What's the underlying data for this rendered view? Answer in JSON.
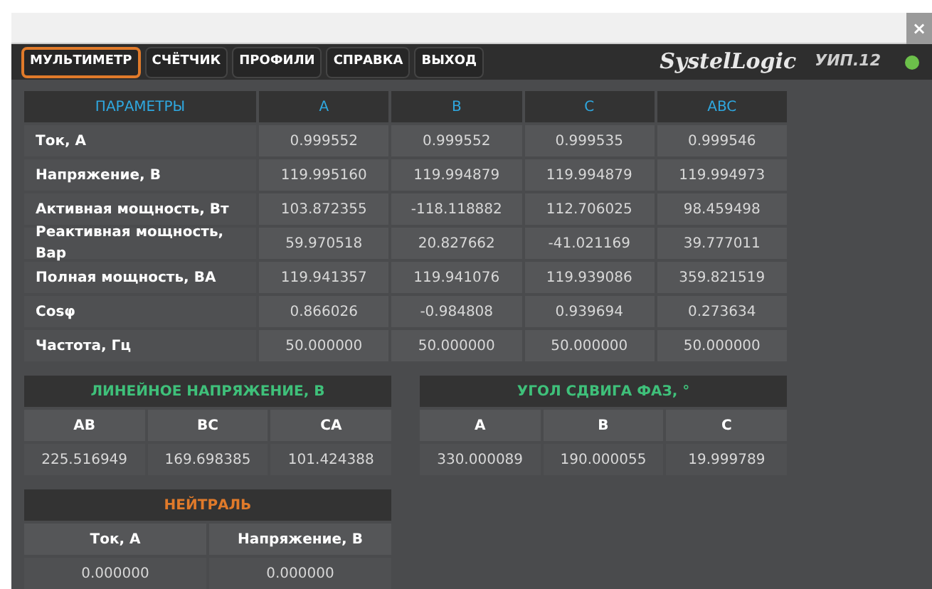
{
  "window": {
    "close": "×"
  },
  "menu": [
    {
      "label": "МУЛЬТИМЕТР",
      "selected": true
    },
    {
      "label": "СЧЁТЧИК",
      "selected": false
    },
    {
      "label": "ПРОФИЛИ",
      "selected": false
    },
    {
      "label": "СПРАВКА",
      "selected": false
    },
    {
      "label": "ВЫХОД",
      "selected": false
    }
  ],
  "brand": {
    "logo": "SystelLogic",
    "device": "УИП.12"
  },
  "parameters": {
    "columns": [
      "ПАРАМЕТРЫ",
      "A",
      "B",
      "C",
      "ABC"
    ],
    "rows": [
      [
        "Ток, А",
        "0.999552",
        "0.999552",
        "0.999535",
        "0.999546"
      ],
      [
        "Напряжение, В",
        "119.995160",
        "119.994879",
        "119.994879",
        "119.994973"
      ],
      [
        "Активная мощность, Вт",
        "103.872355",
        "-118.118882",
        "112.706025",
        "98.459498"
      ],
      [
        "Реактивная мощность, Вар",
        "59.970518",
        "20.827662",
        "-41.021169",
        "39.777011"
      ],
      [
        "Полная мощность, ВА",
        "119.941357",
        "119.941076",
        "119.939086",
        "359.821519"
      ],
      [
        "Cosφ",
        "0.866026",
        "-0.984808",
        "0.939694",
        "0.273634"
      ],
      [
        "Частота, Гц",
        "50.000000",
        "50.000000",
        "50.000000",
        "50.000000"
      ]
    ]
  },
  "line_voltage": {
    "title": "ЛИНЕЙНОЕ НАПРЯЖЕНИЕ, В",
    "columns": [
      "AB",
      "BC",
      "CA"
    ],
    "values": [
      "225.516949",
      "169.698385",
      "101.424388"
    ]
  },
  "phase_angle": {
    "title": "УГОЛ СДВИГА ФАЗ, °",
    "columns": [
      "A",
      "B",
      "C"
    ],
    "values": [
      "330.000089",
      "190.000055",
      "19.999789"
    ]
  },
  "neutral": {
    "title": "НЕЙТРАЛЬ",
    "columns": [
      "Ток, А",
      "Напряжение, В"
    ],
    "values": [
      "0.000000",
      "0.000000"
    ]
  }
}
